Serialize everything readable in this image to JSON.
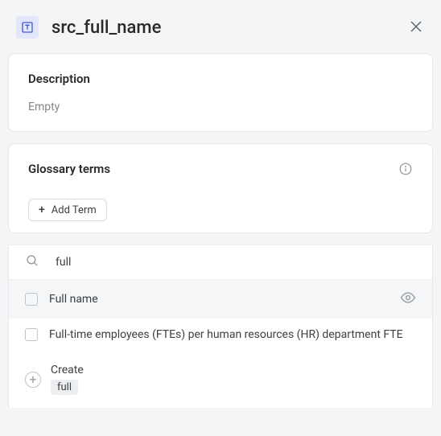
{
  "header": {
    "title": "src_full_name"
  },
  "description": {
    "title": "Description",
    "value": "Empty"
  },
  "glossary": {
    "title": "Glossary terms",
    "add_term_label": "Add Term"
  },
  "search": {
    "query": "full"
  },
  "results": [
    {
      "label": "Full name"
    },
    {
      "label": "Full-time employees (FTEs) per human resources (HR) department FTE"
    }
  ],
  "create": {
    "label": "Create",
    "term": "full"
  }
}
